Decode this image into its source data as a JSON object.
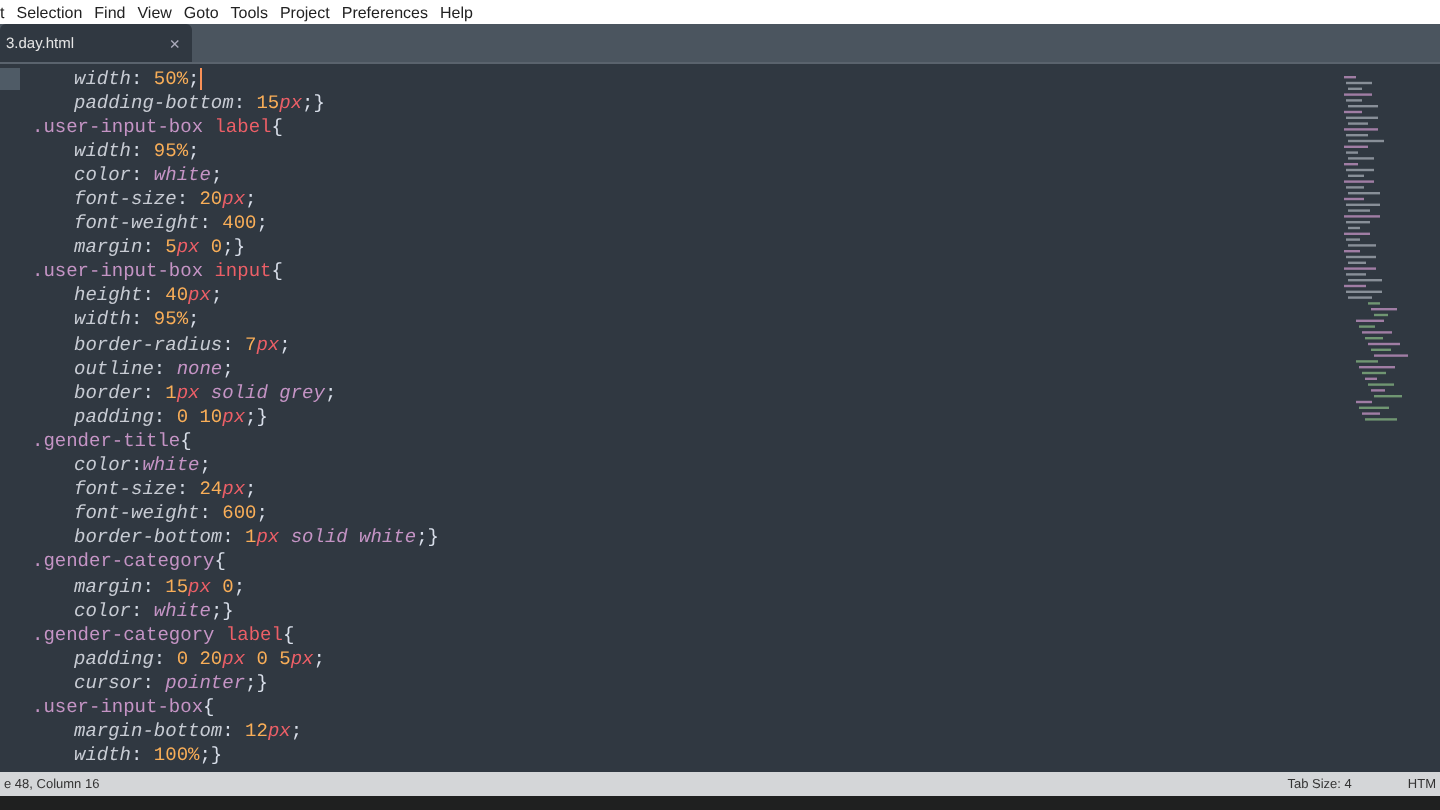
{
  "menu_bar": {
    "items": [
      "t",
      "Selection",
      "Find",
      "View",
      "Goto",
      "Tools",
      "Project",
      "Preferences",
      "Help"
    ]
  },
  "tabs": [
    {
      "label": "3.day.html",
      "selected": true,
      "close": "×"
    }
  ],
  "editor": {
    "lines": [
      {
        "kind": "declaration",
        "current": true,
        "tokens": [
          {
            "kind": "property",
            "text": "width"
          },
          {
            "kind": "punct",
            "text": ": "
          },
          {
            "kind": "number",
            "text": "50"
          },
          {
            "kind": "number",
            "text": "%"
          },
          {
            "kind": "punct",
            "text": ";"
          }
        ]
      },
      {
        "kind": "declaration",
        "current": false,
        "tokens": [
          {
            "kind": "property",
            "text": "padding-bottom"
          },
          {
            "kind": "punct",
            "text": ": "
          },
          {
            "kind": "number",
            "text": "15"
          },
          {
            "kind": "unit",
            "text": "px"
          },
          {
            "kind": "punct",
            "text": ";}"
          }
        ]
      },
      {
        "kind": "rule",
        "current": false,
        "tokens": [
          {
            "kind": "selector",
            "text": ".user-input-box "
          },
          {
            "kind": "tag",
            "text": "label"
          },
          {
            "kind": "punct",
            "text": "{"
          }
        ]
      },
      {
        "kind": "declaration",
        "current": false,
        "tokens": [
          {
            "kind": "property",
            "text": "width"
          },
          {
            "kind": "punct",
            "text": ": "
          },
          {
            "kind": "number",
            "text": "95"
          },
          {
            "kind": "number",
            "text": "%"
          },
          {
            "kind": "punct",
            "text": ";"
          }
        ]
      },
      {
        "kind": "declaration",
        "current": false,
        "tokens": [
          {
            "kind": "property",
            "text": "color"
          },
          {
            "kind": "punct",
            "text": ": "
          },
          {
            "kind": "keyword",
            "text": "white"
          },
          {
            "kind": "punct",
            "text": ";"
          }
        ]
      },
      {
        "kind": "declaration",
        "current": false,
        "tokens": [
          {
            "kind": "property",
            "text": "font-size"
          },
          {
            "kind": "punct",
            "text": ": "
          },
          {
            "kind": "number",
            "text": "20"
          },
          {
            "kind": "unit",
            "text": "px"
          },
          {
            "kind": "punct",
            "text": ";"
          }
        ]
      },
      {
        "kind": "declaration",
        "current": false,
        "tokens": [
          {
            "kind": "property",
            "text": "font-weight"
          },
          {
            "kind": "punct",
            "text": ": "
          },
          {
            "kind": "number",
            "text": "400"
          },
          {
            "kind": "punct",
            "text": ";"
          }
        ]
      },
      {
        "kind": "declaration",
        "current": false,
        "tokens": [
          {
            "kind": "property",
            "text": "margin"
          },
          {
            "kind": "punct",
            "text": ": "
          },
          {
            "kind": "number",
            "text": "5"
          },
          {
            "kind": "unit",
            "text": "px"
          },
          {
            "kind": "number",
            "text": " 0"
          },
          {
            "kind": "punct",
            "text": ";}"
          }
        ]
      },
      {
        "kind": "rule",
        "current": false,
        "tokens": [
          {
            "kind": "selector",
            "text": ".user-input-box "
          },
          {
            "kind": "tag",
            "text": "input"
          },
          {
            "kind": "punct",
            "text": "{"
          }
        ]
      },
      {
        "kind": "declaration",
        "current": false,
        "tokens": [
          {
            "kind": "property",
            "text": "height"
          },
          {
            "kind": "punct",
            "text": ": "
          },
          {
            "kind": "number",
            "text": "40"
          },
          {
            "kind": "unit",
            "text": "px"
          },
          {
            "kind": "punct",
            "text": ";"
          }
        ]
      },
      {
        "kind": "declaration",
        "current": false,
        "tokens": [
          {
            "kind": "property",
            "text": "width"
          },
          {
            "kind": "punct",
            "text": ": "
          },
          {
            "kind": "number",
            "text": "95"
          },
          {
            "kind": "number",
            "text": "%"
          },
          {
            "kind": "punct",
            "text": ";"
          }
        ]
      },
      {
        "kind": "declaration",
        "current": false,
        "tokens": [
          {
            "kind": "property",
            "text": "border-radius"
          },
          {
            "kind": "punct",
            "text": ": "
          },
          {
            "kind": "number",
            "text": "7"
          },
          {
            "kind": "unit",
            "text": "px"
          },
          {
            "kind": "punct",
            "text": ";"
          }
        ]
      },
      {
        "kind": "declaration",
        "current": false,
        "tokens": [
          {
            "kind": "property",
            "text": "outline"
          },
          {
            "kind": "punct",
            "text": ": "
          },
          {
            "kind": "keyword",
            "text": "none"
          },
          {
            "kind": "punct",
            "text": ";"
          }
        ]
      },
      {
        "kind": "declaration",
        "current": false,
        "tokens": [
          {
            "kind": "property",
            "text": "border"
          },
          {
            "kind": "punct",
            "text": ": "
          },
          {
            "kind": "number",
            "text": "1"
          },
          {
            "kind": "unit",
            "text": "px"
          },
          {
            "kind": "keyword",
            "text": " solid grey"
          },
          {
            "kind": "punct",
            "text": ";"
          }
        ]
      },
      {
        "kind": "declaration",
        "current": false,
        "tokens": [
          {
            "kind": "property",
            "text": "padding"
          },
          {
            "kind": "punct",
            "text": ": "
          },
          {
            "kind": "number",
            "text": "0"
          },
          {
            "kind": "number",
            "text": " 10"
          },
          {
            "kind": "unit",
            "text": "px"
          },
          {
            "kind": "punct",
            "text": ";}"
          }
        ]
      },
      {
        "kind": "rule",
        "current": false,
        "tokens": [
          {
            "kind": "selector",
            "text": ".gender-title"
          },
          {
            "kind": "punct",
            "text": "{"
          }
        ]
      },
      {
        "kind": "declaration",
        "current": false,
        "tokens": [
          {
            "kind": "property",
            "text": "color"
          },
          {
            "kind": "punct",
            "text": ":"
          },
          {
            "kind": "keyword",
            "text": "white"
          },
          {
            "kind": "punct",
            "text": ";"
          }
        ]
      },
      {
        "kind": "declaration",
        "current": false,
        "tokens": [
          {
            "kind": "property",
            "text": "font-size"
          },
          {
            "kind": "punct",
            "text": ": "
          },
          {
            "kind": "number",
            "text": "24"
          },
          {
            "kind": "unit",
            "text": "px"
          },
          {
            "kind": "punct",
            "text": ";"
          }
        ]
      },
      {
        "kind": "declaration",
        "current": false,
        "tokens": [
          {
            "kind": "property",
            "text": "font-weight"
          },
          {
            "kind": "punct",
            "text": ": "
          },
          {
            "kind": "number",
            "text": "600"
          },
          {
            "kind": "punct",
            "text": ";"
          }
        ]
      },
      {
        "kind": "declaration",
        "current": false,
        "tokens": [
          {
            "kind": "property",
            "text": "border-bottom"
          },
          {
            "kind": "punct",
            "text": ": "
          },
          {
            "kind": "number",
            "text": "1"
          },
          {
            "kind": "unit",
            "text": "px"
          },
          {
            "kind": "keyword",
            "text": " solid white"
          },
          {
            "kind": "punct",
            "text": ";}"
          }
        ]
      },
      {
        "kind": "rule",
        "current": false,
        "tokens": [
          {
            "kind": "selector",
            "text": ".gender-category"
          },
          {
            "kind": "punct",
            "text": "{"
          }
        ]
      },
      {
        "kind": "declaration",
        "current": false,
        "tokens": [
          {
            "kind": "property",
            "text": "margin"
          },
          {
            "kind": "punct",
            "text": ": "
          },
          {
            "kind": "number",
            "text": "15"
          },
          {
            "kind": "unit",
            "text": "px"
          },
          {
            "kind": "number",
            "text": " 0"
          },
          {
            "kind": "punct",
            "text": ";"
          }
        ]
      },
      {
        "kind": "declaration",
        "current": false,
        "tokens": [
          {
            "kind": "property",
            "text": "color"
          },
          {
            "kind": "punct",
            "text": ": "
          },
          {
            "kind": "keyword",
            "text": "white"
          },
          {
            "kind": "punct",
            "text": ";}"
          }
        ]
      },
      {
        "kind": "rule",
        "current": false,
        "tokens": [
          {
            "kind": "selector",
            "text": ".gender-category "
          },
          {
            "kind": "tag",
            "text": "label"
          },
          {
            "kind": "punct",
            "text": "{"
          }
        ]
      },
      {
        "kind": "declaration",
        "current": false,
        "tokens": [
          {
            "kind": "property",
            "text": "padding"
          },
          {
            "kind": "punct",
            "text": ": "
          },
          {
            "kind": "number",
            "text": "0"
          },
          {
            "kind": "number",
            "text": " 20"
          },
          {
            "kind": "unit",
            "text": "px"
          },
          {
            "kind": "number",
            "text": " 0"
          },
          {
            "kind": "number",
            "text": " 5"
          },
          {
            "kind": "unit",
            "text": "px"
          },
          {
            "kind": "punct",
            "text": ";"
          }
        ]
      },
      {
        "kind": "declaration",
        "current": false,
        "tokens": [
          {
            "kind": "property",
            "text": "cursor"
          },
          {
            "kind": "punct",
            "text": ": "
          },
          {
            "kind": "keyword",
            "text": "pointer"
          },
          {
            "kind": "punct",
            "text": ";}"
          }
        ]
      },
      {
        "kind": "rule",
        "current": false,
        "tokens": [
          {
            "kind": "selector",
            "text": ".user-input-box"
          },
          {
            "kind": "punct",
            "text": "{"
          }
        ]
      },
      {
        "kind": "declaration",
        "current": false,
        "tokens": [
          {
            "kind": "property",
            "text": "margin-bottom"
          },
          {
            "kind": "punct",
            "text": ": "
          },
          {
            "kind": "number",
            "text": "12"
          },
          {
            "kind": "unit",
            "text": "px"
          },
          {
            "kind": "punct",
            "text": ";"
          }
        ]
      },
      {
        "kind": "declaration",
        "current": false,
        "tokens": [
          {
            "kind": "property",
            "text": "width"
          },
          {
            "kind": "punct",
            "text": ": "
          },
          {
            "kind": "number",
            "text": "100"
          },
          {
            "kind": "number",
            "text": "%"
          },
          {
            "kind": "punct",
            "text": ";}"
          }
        ]
      }
    ]
  },
  "status_bar": {
    "position": "e 48, Column 16",
    "tab_size": "Tab Size: 4",
    "syntax": "HTM"
  }
}
